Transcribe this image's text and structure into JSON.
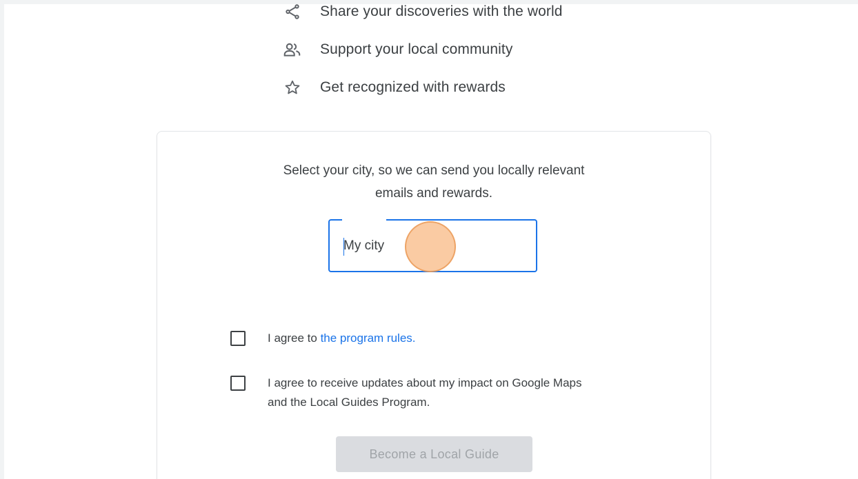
{
  "benefits": [
    {
      "icon": "share-icon",
      "text": "Share your discoveries with the world"
    },
    {
      "icon": "community-icon",
      "text": "Support your local community"
    },
    {
      "icon": "star-icon",
      "text": "Get recognized with rewards"
    }
  ],
  "signup": {
    "intro_line1": "Select your city, so we can send you locally relevant",
    "intro_line2": "emails and rewards.",
    "city_placeholder": "My city",
    "city_value": "",
    "rules_prefix": "I agree to ",
    "rules_link": "the program rules.",
    "updates_line1": "I agree to receive updates about my impact on Google Maps",
    "updates_line2": "and the Local Guides Program.",
    "submit_label": "Become a Local Guide"
  },
  "colors": {
    "accent": "#1a73e8",
    "text": "#3c4043",
    "disabled_button_bg": "#dadce0",
    "disabled_button_text": "#a0a4a8",
    "click_indicator": "#f8b278"
  }
}
